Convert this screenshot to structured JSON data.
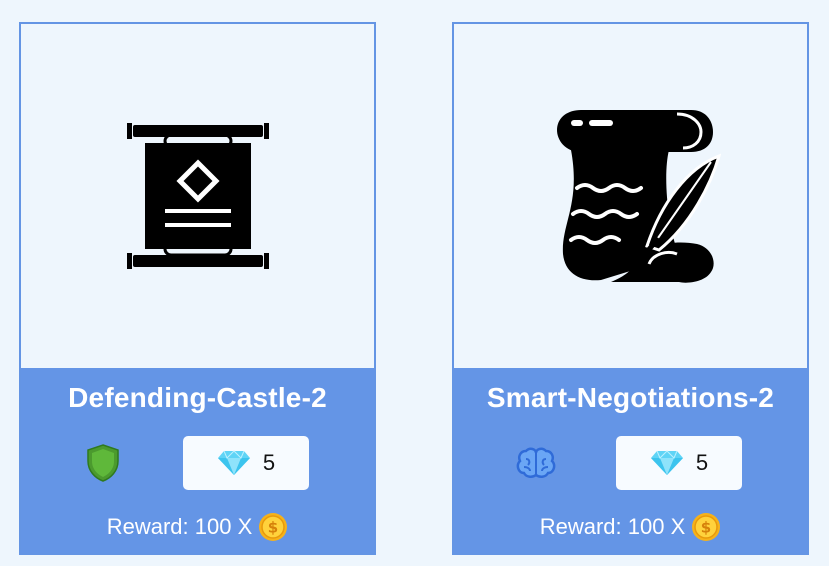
{
  "cards": [
    {
      "title": "Defending-Castle-2",
      "image_icon": "scroll-banner-icon",
      "category_icon": "shield-icon",
      "cost_icon": "diamond-icon",
      "cost": "5",
      "reward_label": "Reward: 100 X",
      "reward_icon": "dollar-coin-icon"
    },
    {
      "title": "Smart-Negotiations-2",
      "image_icon": "scroll-quill-icon",
      "category_icon": "brain-icon",
      "cost_icon": "diamond-icon",
      "cost": "5",
      "reward_label": "Reward: 100 X",
      "reward_icon": "dollar-coin-icon"
    }
  ],
  "colors": {
    "card_footer": "#6495e6",
    "card_border": "#6495e4",
    "background": "#eef6fd",
    "shield": "#4b9a2e",
    "brain": "#2f6bd8",
    "diamond": "#3cc4ee",
    "coin": "#f6b21a"
  }
}
